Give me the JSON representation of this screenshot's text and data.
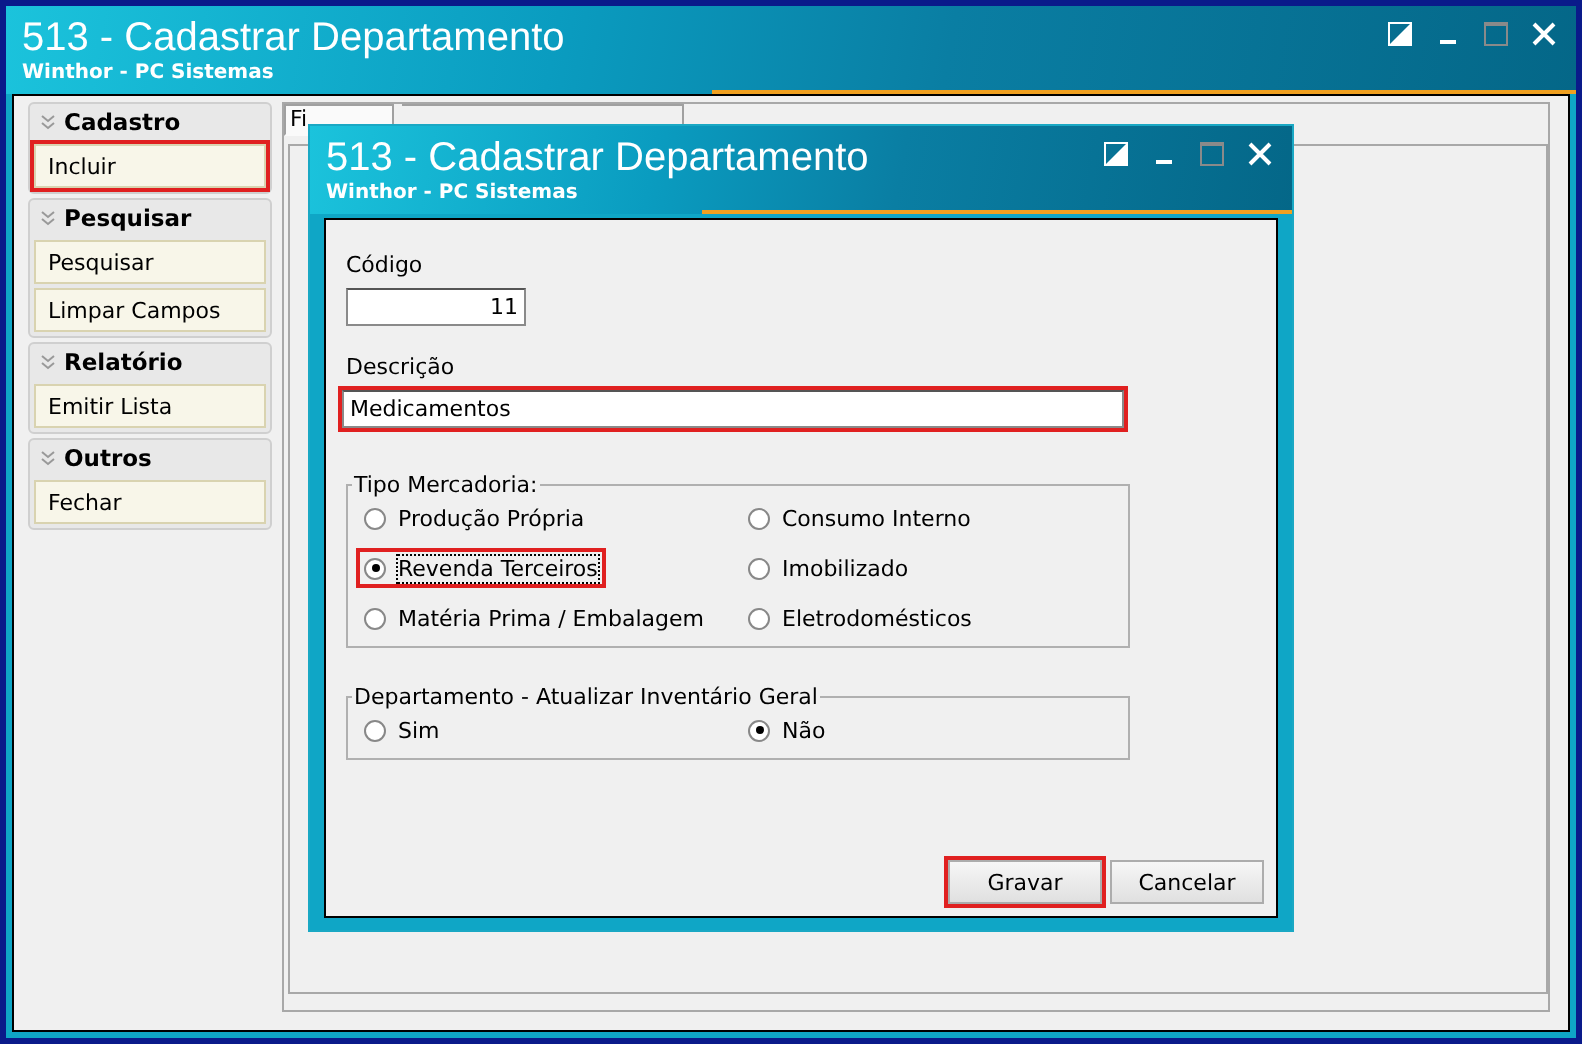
{
  "window": {
    "title": "513 - Cadastrar Departamento",
    "subtitle": "Winthor - PC Sistemas"
  },
  "sidebar": [
    {
      "title": "Cadastro",
      "items": [
        {
          "label": "Incluir",
          "highlighted": true
        }
      ]
    },
    {
      "title": "Pesquisar",
      "items": [
        {
          "label": "Pesquisar",
          "highlighted": false
        },
        {
          "label": "Limpar Campos",
          "highlighted": false
        }
      ]
    },
    {
      "title": "Relatório",
      "items": [
        {
          "label": "Emitir Lista",
          "highlighted": false
        }
      ]
    },
    {
      "title": "Outros",
      "items": [
        {
          "label": "Fechar",
          "highlighted": false
        }
      ]
    }
  ],
  "tabs": [
    {
      "label": "Fi",
      "selected": true
    }
  ],
  "dialog": {
    "title": "513 - Cadastrar Departamento",
    "subtitle": "Winthor - PC Sistemas",
    "codigo": {
      "label": "Código",
      "value": "11"
    },
    "descricao": {
      "label": "Descrição",
      "value": "Medicamentos",
      "highlighted": true
    },
    "tipo_mercadoria": {
      "legend": "Tipo Mercadoria:",
      "options": [
        {
          "label": "Produção Própria",
          "selected": false,
          "highlighted": false
        },
        {
          "label": "Consumo Interno",
          "selected": false,
          "highlighted": false
        },
        {
          "label": "Revenda Terceiros",
          "selected": true,
          "highlighted": true
        },
        {
          "label": "Imobilizado",
          "selected": false,
          "highlighted": false
        },
        {
          "label": "Matéria Prima / Embalagem",
          "selected": false,
          "highlighted": false
        },
        {
          "label": "Eletrodomésticos",
          "selected": false,
          "highlighted": false
        }
      ]
    },
    "inventario": {
      "legend": "Departamento - Atualizar Inventário Geral",
      "options": [
        {
          "label": "Sim",
          "selected": false
        },
        {
          "label": "Não",
          "selected": true
        }
      ]
    },
    "buttons": [
      {
        "label": "Gravar",
        "highlighted": true
      },
      {
        "label": "Cancelar",
        "highlighted": false
      }
    ]
  }
}
